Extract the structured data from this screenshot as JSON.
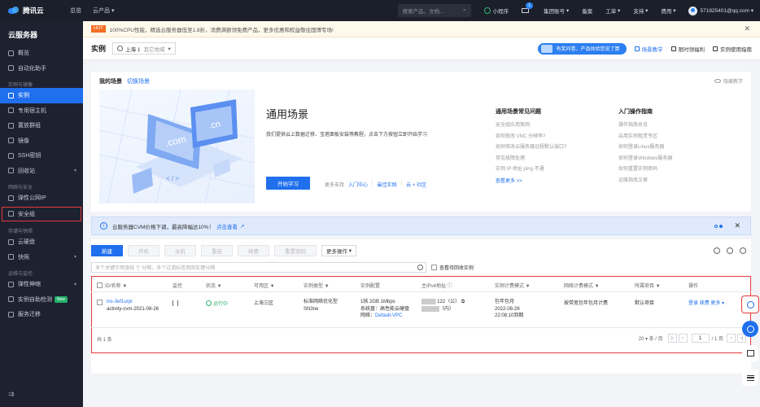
{
  "topbar": {
    "brand": "腾讯云",
    "home": "总览",
    "products": "云产品",
    "search_placeholder": "搜索产品、文档...",
    "mini_program": "小程序",
    "mail_count": "1",
    "group_account": "集团账号",
    "record": "备案",
    "tickets": "工单",
    "support": "支持",
    "billing": "费用",
    "account": "571825401@qq.com"
  },
  "sidebar": {
    "title": "云服务器",
    "items": [
      {
        "label": "概览"
      },
      {
        "label": "自动化助手"
      }
    ],
    "group1": "实例与镜像",
    "group1_items": [
      {
        "label": "实例"
      },
      {
        "label": "专用宿主机"
      },
      {
        "label": "置放群组"
      },
      {
        "label": "镜像"
      },
      {
        "label": "SSH密钥"
      },
      {
        "label": "回收站"
      }
    ],
    "group2": "网络与安全",
    "group2_items": [
      {
        "label": "弹性公网IP"
      },
      {
        "label": "安全组"
      }
    ],
    "group3": "存储与快照",
    "group3_items": [
      {
        "label": "云硬盘"
      },
      {
        "label": "快照"
      }
    ],
    "group4": "运维与监控",
    "group4_items": [
      {
        "label": "弹性伸缩"
      },
      {
        "label": "实例自助检测"
      },
      {
        "label": "服务迁移"
      }
    ],
    "new_tag": "New",
    "collapse": "⇉"
  },
  "notice": {
    "hot": "HOT",
    "text": "100%CPU性能，精选云服务器低至1.8折，消费满额领免费产品，更多优惠和权益敬往国博专场!"
  },
  "header": {
    "title": "实例",
    "region": "上海 1",
    "region_sub": "其它地域",
    "promo": "有奖问卷，产品体验您说了算",
    "scene_tutorial": "场景教学",
    "time_limit": "限时领福利",
    "instance_guide": "实例使用指南"
  },
  "scene_card": {
    "my_scene": "我的场景",
    "switch_scene": "切换场景",
    "hide_tutorial": "隐藏教学",
    "title": "通用场景",
    "desc": "我们提供云上数据迁移、宝塔面板安装等教程，点击下方按钮立即开始学习",
    "start_button": "开始学习",
    "more_support": "更多支持",
    "links": [
      "入门中心",
      "最佳实践",
      "云 + 社区"
    ],
    "faq_title": "通用场景常见问题",
    "faq": [
      "安全组应用案例",
      "如何修改 VNC 分辨率?",
      "如何修改云服务器远程默认端口?",
      "常见故障处理",
      "实例 IP 地址 ping 不通"
    ],
    "faq_more": "查看更多 >>",
    "guide_title": "入门操作指南",
    "guide": [
      "操作指南总览",
      "启用实例租赁专区",
      "如何登录Linux服务器",
      "如何登录Windows服务器",
      "如何重置实例密码",
      "运维指南文章"
    ],
    "illus_text": [
      ".com",
      ".cn",
      "< / >"
    ]
  },
  "info": {
    "text": "云服务器CVM价格下调，最高降幅达10%！",
    "link": "点击查看"
  },
  "toolbar": {
    "new": "新建",
    "start": "开机",
    "shutdown": "关机",
    "restart": "重启",
    "renew": "续费",
    "reset_password": "重置密码",
    "more_ops": "更多操作",
    "search_placeholder": "多个关键字用竖线 \"|\" 分隔，多个过滤标签用回车键分隔",
    "recycle_label": "查看待回收实例"
  },
  "table": {
    "headers": [
      "ID/名称",
      "监控",
      "状态",
      "可用区",
      "实例类型",
      "实例配置",
      "主IPv4地址",
      "实例计费模式",
      "网络计费模式",
      "所属项目",
      "操作"
    ],
    "row": {
      "id": "ins-3ef1urpr",
      "name": "activity-cvm-2021-08-26",
      "status": "运行中",
      "zone": "上海三区",
      "type_1": "标准网络优化型",
      "type_2": "SN3ne",
      "config_1": "1核 2GB 1Mbps",
      "config_2": "系统盘：高性能云硬盘",
      "config_3_label": "网络：",
      "config_3_value": "Default-VPC",
      "ip_public": "122（公）",
      "ip_private": "（内）",
      "billing_1": "包年包月",
      "billing_2": "2022-08-26",
      "billing_3": "22:08:10到期",
      "net_billing": "按带宽包年包月计费",
      "project": "默认项目",
      "op_login": "登录",
      "op_renew": "续费",
      "op_more": "更多"
    },
    "total": "共 1 条",
    "page_size": "20",
    "page_size_unit": "条 / 页",
    "page": "1",
    "page_total": "/ 1 页"
  }
}
